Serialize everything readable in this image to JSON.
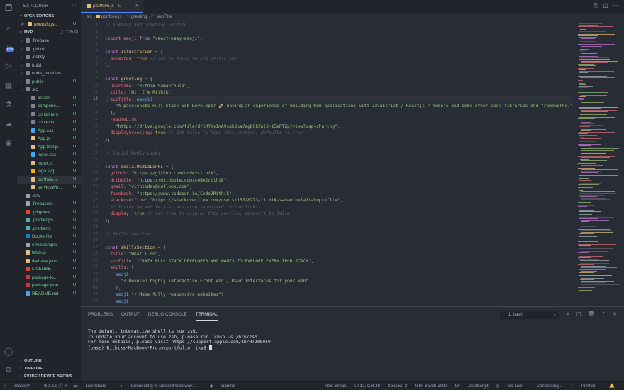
{
  "activity": {
    "icons": [
      "files-icon",
      "search-icon",
      "source-control-icon",
      "run-debug-icon",
      "extensions-icon",
      "testing-icon",
      "remote-explorer-icon",
      "github-icon"
    ],
    "scm_badge": "678",
    "bottom_icons": [
      "account-icon",
      "settings-gear-icon"
    ]
  },
  "sidebar": {
    "title": "EXPLORER",
    "open_editors_label": "OPEN EDITORS",
    "open_file": "portfolio.js...",
    "open_file_status": "U",
    "project_label": "MYP...",
    "tree": [
      {
        "name": ".firebase",
        "type": "folder",
        "depth": 1,
        "status": ""
      },
      {
        "name": ".github",
        "type": "folder",
        "depth": 1,
        "status": ""
      },
      {
        "name": ".netlify",
        "type": "folder",
        "depth": 1,
        "status": ""
      },
      {
        "name": "build",
        "type": "folder",
        "depth": 1,
        "status": ""
      },
      {
        "name": "node_modules",
        "type": "folder",
        "depth": 1,
        "status": ""
      },
      {
        "name": "public",
        "type": "folder",
        "depth": 1,
        "status": "U"
      },
      {
        "name": "src",
        "type": "folder-open",
        "depth": 1,
        "status": ""
      },
      {
        "name": "assets",
        "type": "folder",
        "depth": 2,
        "status": "U"
      },
      {
        "name": "compone...",
        "type": "folder",
        "depth": 2,
        "status": "U"
      },
      {
        "name": "containers",
        "type": "folder",
        "depth": 2,
        "status": "U"
      },
      {
        "name": "contexts",
        "type": "folder",
        "depth": 2,
        "status": "U"
      },
      {
        "name": "App.css",
        "type": "css",
        "depth": 2,
        "status": "U"
      },
      {
        "name": "App.js",
        "type": "js",
        "depth": 2,
        "status": "U"
      },
      {
        "name": "App.test.js",
        "type": "js",
        "depth": 2,
        "status": "U"
      },
      {
        "name": "index.css",
        "type": "css",
        "depth": 2,
        "status": "U"
      },
      {
        "name": "index.js",
        "type": "js",
        "depth": 2,
        "status": "U"
      },
      {
        "name": "logo.svg",
        "type": "svg",
        "depth": 2,
        "status": "U"
      },
      {
        "name": "portfolio.js",
        "type": "js",
        "depth": 2,
        "status": "U"
      },
      {
        "name": "serviceWo...",
        "type": "js",
        "depth": 2,
        "status": "U"
      },
      {
        "name": ".env",
        "type": "file",
        "depth": 1,
        "status": ""
      },
      {
        "name": ".firebaserc",
        "type": "file",
        "depth": 1,
        "status": "U"
      },
      {
        "name": ".gitignore",
        "type": "git",
        "depth": 1,
        "status": "U"
      },
      {
        "name": ".prettierign...",
        "type": "prettier",
        "depth": 1,
        "status": "U"
      },
      {
        "name": ".prettierrc",
        "type": "prettier",
        "depth": 1,
        "status": "U"
      },
      {
        "name": "Dockerfile",
        "type": "docker",
        "depth": 1,
        "status": "U"
      },
      {
        "name": "env.example",
        "type": "file",
        "depth": 1,
        "status": "U"
      },
      {
        "name": "fetch.js",
        "type": "js",
        "depth": 1,
        "status": "U"
      },
      {
        "name": "firebase.json",
        "type": "json",
        "depth": 1,
        "status": "U"
      },
      {
        "name": "LICENSE",
        "type": "license",
        "depth": 1,
        "status": "U"
      },
      {
        "name": "package-lo...",
        "type": "npm",
        "depth": 1,
        "status": "U"
      },
      {
        "name": "package.json",
        "type": "npm",
        "depth": 1,
        "status": "U"
      },
      {
        "name": "README.md",
        "type": "md",
        "depth": 1,
        "status": "U"
      }
    ],
    "selected_index": 17,
    "bottom_sections": [
      "OUTLINE",
      "TIMELINE",
      "EV3DEV DEVICE BROWS..."
    ]
  },
  "editor": {
    "tab_label": "portfolio.js",
    "tab_status": "U",
    "breadcrumb": [
      "src",
      "portfolio.js",
      "greeting",
      "subTitle"
    ],
    "current_line": 12,
    "lines": [
      {
        "n": 1,
        "t": [
          [
            "c",
            "// Summary And Greeting Section"
          ]
        ]
      },
      {
        "n": 2,
        "t": []
      },
      {
        "n": 3,
        "t": [
          [
            "k",
            "import "
          ],
          [
            "p",
            "emoji"
          ],
          [
            "k",
            " from "
          ],
          [
            "s",
            "\"react-easy-emoji\""
          ],
          [
            "",
            "; "
          ]
        ]
      },
      {
        "n": 4,
        "t": []
      },
      {
        "n": 5,
        "t": [
          [
            "k",
            "const "
          ],
          [
            "v",
            "illustration"
          ],
          [
            "",
            " = {"
          ]
        ]
      },
      {
        "n": 6,
        "t": [
          [
            "",
            "  "
          ],
          [
            "p",
            "animated"
          ],
          [
            ": "
          ],
          [
            "n",
            "true"
          ],
          [
            "c",
            " // set to false to use static SVG"
          ]
        ]
      },
      {
        "n": 7,
        "t": [
          [
            "",
            "};"
          ]
        ]
      },
      {
        "n": 8,
        "t": []
      },
      {
        "n": 9,
        "t": [
          [
            "k",
            "const "
          ],
          [
            "v",
            "greeting"
          ],
          [
            "",
            " = {"
          ]
        ]
      },
      {
        "n": 10,
        "t": [
          [
            "",
            "  "
          ],
          [
            "p",
            "username"
          ],
          [
            "",
            ": "
          ],
          [
            "s",
            "\"Rithik Samanthula\""
          ],
          [
            "",
            ","
          ]
        ]
      },
      {
        "n": 11,
        "t": [
          [
            "",
            "  "
          ],
          [
            "p",
            "title"
          ],
          [
            "",
            ": "
          ],
          [
            "s",
            "\"Hi, I'm Rithik\""
          ],
          [
            "",
            ","
          ]
        ]
      },
      {
        "n": 12,
        "t": [
          [
            "",
            "  "
          ],
          [
            "p",
            "subTitle"
          ],
          [
            "",
            ": "
          ],
          [
            "f",
            "emoji"
          ],
          [
            "",
            "("
          ]
        ]
      },
      {
        "n": 13,
        "t": [
          [
            "",
            "    "
          ],
          [
            "s",
            "\"A passionate Full Stack Web Developer 🚀 having an experience of building Web applications with JavaScript / Reactjs / Nodejs and some other cool libraries and frameworks.\""
          ]
        ]
      },
      {
        "n": 14,
        "t": [
          [
            "",
            "  ),"
          ]
        ]
      },
      {
        "n": 15,
        "t": [
          [
            "",
            "  "
          ],
          [
            "p",
            "resumeLink"
          ],
          [
            "",
            ":"
          ]
        ]
      },
      {
        "n": 16,
        "t": [
          [
            "",
            "    "
          ],
          [
            "s",
            "\"https://drive.google.com/file/d/1MTkvImA9cak3ua7egDCkFujJ-15ePTZp/view?usp=sharing\""
          ],
          [
            "",
            ","
          ]
        ]
      },
      {
        "n": 17,
        "t": [
          [
            "",
            "  "
          ],
          [
            "p",
            "displayGreeting"
          ],
          [
            "",
            ": "
          ],
          [
            "n",
            "true"
          ],
          [
            "c",
            " // Set false to hide this section, defaults to true"
          ]
        ]
      },
      {
        "n": 18,
        "t": [
          [
            "",
            "};"
          ]
        ]
      },
      {
        "n": 19,
        "t": []
      },
      {
        "n": 20,
        "t": [
          [
            "c",
            "// Social Media Links"
          ]
        ]
      },
      {
        "n": 21,
        "t": []
      },
      {
        "n": 22,
        "t": [
          [
            "k",
            "const "
          ],
          [
            "v",
            "socialMediaLinks"
          ],
          [
            "",
            " = {"
          ]
        ]
      },
      {
        "n": 23,
        "t": [
          [
            "",
            "  "
          ],
          [
            "p",
            "github"
          ],
          [
            "",
            ": "
          ],
          [
            "s",
            "\"https://github.com/code2rithik\""
          ],
          [
            "",
            ","
          ]
        ]
      },
      {
        "n": 24,
        "t": [
          [
            "",
            "  "
          ],
          [
            "p",
            "dribbble"
          ],
          [
            "",
            ": "
          ],
          [
            "s",
            "\"https://dribbble.com/code2rithik\""
          ],
          [
            "",
            ","
          ]
        ]
      },
      {
        "n": 25,
        "t": [
          [
            "",
            "  "
          ],
          [
            "p",
            "gmail"
          ],
          [
            "",
            ": "
          ],
          [
            "s",
            "\"rithikdev@outlook.com\""
          ],
          [
            "",
            ","
          ]
        ]
      },
      {
        "n": 26,
        "t": [
          [
            "",
            "  "
          ],
          [
            "p",
            "facebook"
          ],
          [
            "",
            ": "
          ],
          [
            "s",
            "\"https://www.codepen.io/Code2Rithik\""
          ],
          [
            "",
            ","
          ]
        ]
      },
      {
        "n": 27,
        "t": [
          [
            "",
            "  "
          ],
          [
            "p",
            "stackoverflow"
          ],
          [
            "",
            ": "
          ],
          [
            "s",
            "\"https://stackoverflow.com/users/15028773/rithik-samanthula?tab=profile\""
          ],
          [
            "",
            ","
          ]
        ]
      },
      {
        "n": 28,
        "t": [
          [
            "",
            "  "
          ],
          [
            "c",
            "// Instagram and Twitter are also supported in the links!"
          ]
        ]
      },
      {
        "n": 29,
        "t": [
          [
            "",
            "  "
          ],
          [
            "p",
            "display"
          ],
          [
            "",
            ": "
          ],
          [
            "n",
            "true"
          ],
          [
            "c",
            " // Set true to display this section, defaults to false"
          ]
        ]
      },
      {
        "n": 30,
        "t": [
          [
            "",
            "};"
          ]
        ]
      },
      {
        "n": 31,
        "t": []
      },
      {
        "n": 32,
        "t": [
          [
            "c",
            "// Skills Section"
          ]
        ]
      },
      {
        "n": 33,
        "t": []
      },
      {
        "n": 34,
        "t": [
          [
            "k",
            "const "
          ],
          [
            "v",
            "skillsSection"
          ],
          [
            "",
            " = {"
          ]
        ]
      },
      {
        "n": 35,
        "t": [
          [
            "",
            "  "
          ],
          [
            "p",
            "title"
          ],
          [
            "",
            ": "
          ],
          [
            "s",
            "\"What I do\""
          ],
          [
            "",
            ","
          ]
        ]
      },
      {
        "n": 36,
        "t": [
          [
            "",
            "  "
          ],
          [
            "p",
            "subTitle"
          ],
          [
            "",
            ": "
          ],
          [
            "s",
            "\"CRAZY FULL STACK DEVELOPER WHO WANTS TO EXPLORE EVERY TECH STACK\""
          ],
          [
            "",
            ","
          ]
        ]
      },
      {
        "n": 37,
        "t": [
          [
            "",
            "  "
          ],
          [
            "p",
            "skills"
          ],
          [
            "",
            ": ["
          ]
        ]
      },
      {
        "n": 38,
        "t": [
          [
            "",
            "    "
          ],
          [
            "f",
            "emoji"
          ],
          [
            "",
            "("
          ]
        ]
      },
      {
        "n": 39,
        "t": [
          [
            "",
            "      "
          ],
          [
            "s",
            "\"⚡ Develop highly interactive Front end / User Interfaces for your web\""
          ]
        ]
      },
      {
        "n": 40,
        "t": [
          [
            "",
            "    ),"
          ]
        ]
      },
      {
        "n": 41,
        "t": [
          [
            "",
            "    "
          ],
          [
            "f",
            "emoji"
          ],
          [
            "",
            "("
          ],
          [
            "s",
            "\"⚡ Make fully responsive websites\""
          ],
          [
            "",
            "),"
          ]
        ]
      },
      {
        "n": 42,
        "t": [
          [
            "",
            "    "
          ],
          [
            "f",
            "emoji"
          ],
          [
            "",
            "("
          ]
        ]
      },
      {
        "n": 43,
        "t": [
          [
            "",
            "      "
          ],
          [
            "s",
            "\"⚡ Use a variety of different technologies and web frameworks\""
          ]
        ]
      }
    ]
  },
  "panel": {
    "tabs": [
      "PROBLEMS",
      "OUTPUT",
      "DEBUG CONSOLE",
      "TERMINAL"
    ],
    "active_tab": 3,
    "shell": "1: bash",
    "tools": [
      "add-terminal-icon",
      "split-terminal-icon",
      "trash-icon",
      "maximize-panel-icon",
      "close-panel-icon"
    ],
    "terminal_lines": [
      "The default interactive shell is now zsh.",
      "To update your account to use zsh, please run `chsh -s /bin/zsh`.",
      "For more details, please visit https://support.apple.com/kb/HT208050.",
      "(base) Rithiks-MacBook-Pro:myportfolio riky$ "
    ]
  },
  "statusbar": {
    "left": [
      "master*",
      "⊗0 ⚠0 ⓘ 0",
      "Live Share",
      "Connecting to Discord Gateway...",
      "tabnine"
    ],
    "right": [
      "Next Break",
      "Ln 12, Col 19",
      "Spaces: 2",
      "UTF-8 with BOM",
      "LF",
      "JavaScript",
      "Go Live",
      "Connecting...",
      "Prettier"
    ]
  }
}
